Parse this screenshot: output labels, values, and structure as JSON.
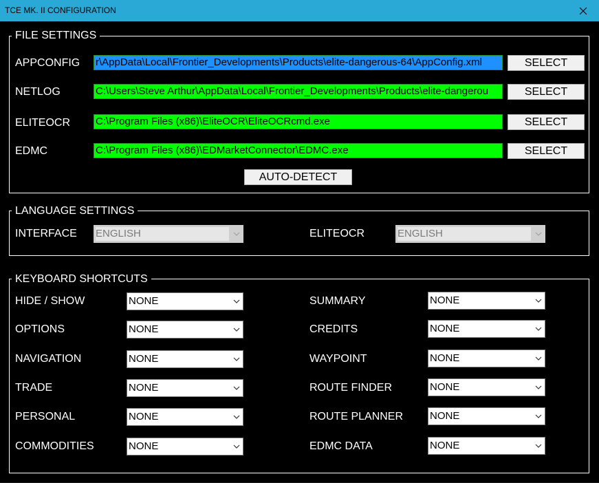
{
  "window": {
    "title": "TCE MK. II CONFIGURATION"
  },
  "file_settings": {
    "legend": "FILE SETTINGS",
    "rows": [
      {
        "label": "APPCONFIG",
        "path": "r\\AppData\\Local\\Frontier_Developments\\Products\\elite-dangerous-64\\AppConfig.xml",
        "button": "SELECT"
      },
      {
        "label": "NETLOG",
        "path": "C:\\Users\\Steve Arthur\\AppData\\Local\\Frontier_Developments\\Products\\elite-dangerou",
        "button": "SELECT"
      },
      {
        "label": "ELITEOCR",
        "path": "C:\\Program Files (x86)\\EliteOCR\\EliteOCRcmd.exe",
        "button": "SELECT"
      },
      {
        "label": "EDMC",
        "path": "C:\\Program Files (x86)\\EDMarketConnector\\EDMC.exe",
        "button": "SELECT"
      }
    ],
    "auto_detect": "AUTO-DETECT"
  },
  "language_settings": {
    "legend": "LANGUAGE SETTINGS",
    "interface_label": "INTERFACE",
    "interface_value": "ENGLISH",
    "eliteocr_label": "ELITEOCR",
    "eliteocr_value": "ENGLISH"
  },
  "keyboard_shortcuts": {
    "legend": "KEYBOARD SHORTCUTS",
    "left": [
      {
        "label": "HIDE / SHOW",
        "value": "NONE"
      },
      {
        "label": "OPTIONS",
        "value": "NONE"
      },
      {
        "label": "NAVIGATION",
        "value": "NONE"
      },
      {
        "label": "TRADE",
        "value": "NONE"
      },
      {
        "label": "PERSONAL",
        "value": "NONE"
      },
      {
        "label": "COMMODITIES",
        "value": "NONE"
      }
    ],
    "right": [
      {
        "label": "SUMMARY",
        "value": "NONE"
      },
      {
        "label": "CREDITS",
        "value": "NONE"
      },
      {
        "label": "WAYPOINT",
        "value": "NONE"
      },
      {
        "label": "ROUTE FINDER",
        "value": "NONE"
      },
      {
        "label": "ROUTE PLANNER",
        "value": "NONE"
      },
      {
        "label": "EDMC DATA",
        "value": "NONE"
      }
    ]
  },
  "colors": {
    "titlebar": "#2aa9d6",
    "path_ok": "#00ff00",
    "path_selected": "#1e90ff",
    "background": "#000000"
  }
}
